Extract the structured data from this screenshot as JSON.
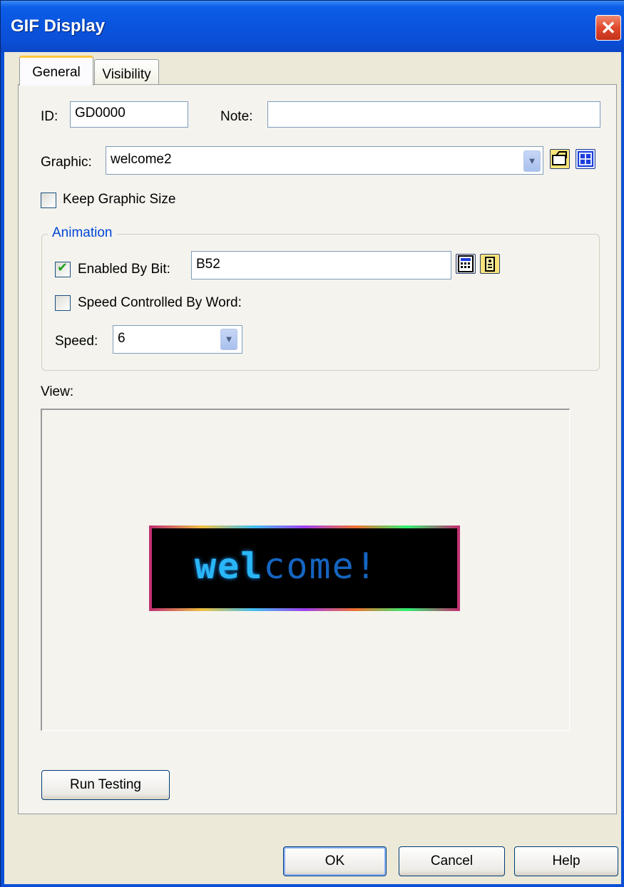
{
  "window": {
    "title": "GIF Display",
    "close_glyph": "✕"
  },
  "tabs": [
    {
      "label": "General",
      "active": true
    },
    {
      "label": "Visibility",
      "active": false
    }
  ],
  "general": {
    "id_label": "ID:",
    "id_value": "GD0000",
    "note_label": "Note:",
    "note_value": "",
    "graphic_label": "Graphic:",
    "graphic_value": "welcome2",
    "keep_size_label": "Keep Graphic Size",
    "keep_size_checked": false
  },
  "animation": {
    "title": "Animation",
    "enabled_label": "Enabled By Bit:",
    "enabled_checked": true,
    "enabled_value": "B52",
    "speed_word_label": "Speed Controlled By Word:",
    "speed_word_checked": false,
    "speed_label": "Speed:",
    "speed_value": "6"
  },
  "view": {
    "label": "View:",
    "banner_part1": "wel",
    "banner_part2": "come!"
  },
  "buttons": {
    "run_testing": "Run Testing",
    "ok": "OK",
    "cancel": "Cancel",
    "help": "Help"
  },
  "icons": {
    "graphic_open": "folder-open-icon",
    "graphic_library": "library-grid-icon",
    "enabled_calculator": "calculator-icon",
    "enabled_tag": "tag-icon"
  },
  "colors": {
    "title_bar": "#0a56e0",
    "accent": "#0046d5",
    "tab_highlight": "#ffc83c"
  }
}
